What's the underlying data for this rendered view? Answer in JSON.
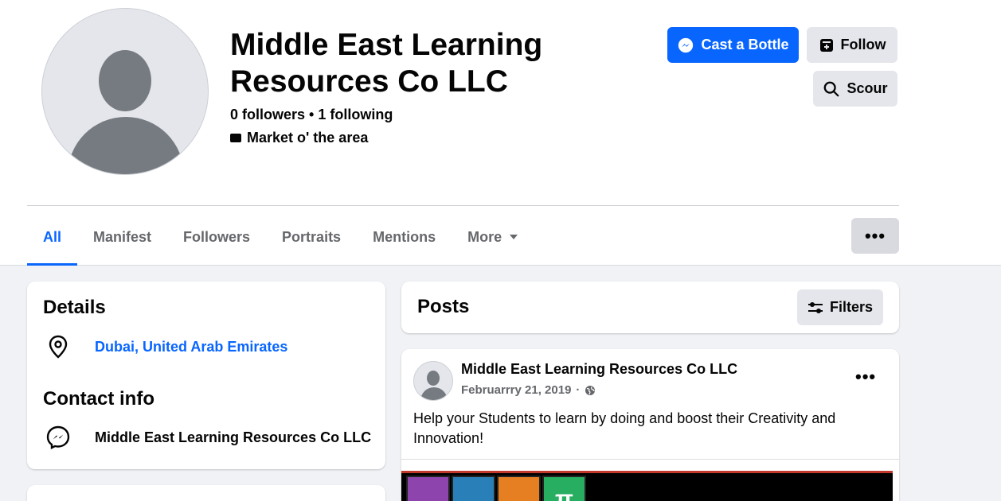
{
  "profile": {
    "name": "Middle East Learning Resources Co LLC",
    "stats": "0 followers • 1 following",
    "category": "Market o' the area"
  },
  "actions": {
    "primary_label": "Cast a Bottle",
    "follow_label": "Follow",
    "search_label": "Scour"
  },
  "tabs": [
    {
      "label": "All",
      "active": true
    },
    {
      "label": "Manifest"
    },
    {
      "label": "Followers"
    },
    {
      "label": "Portraits"
    },
    {
      "label": "Mentions"
    },
    {
      "label": "More"
    }
  ],
  "details": {
    "heading": "Details",
    "location": "Dubai, United Arab Emirates",
    "contact_heading": "Contact info",
    "messenger_name": "Middle East Learning Resources Co LLC"
  },
  "posts": {
    "heading": "Posts",
    "filters_label": "Filters"
  },
  "post": {
    "author": "Middle East Learning Resources Co LLC",
    "date": "Februarrry 21, 2019",
    "separator": "·",
    "text": "Help your  Students to  learn by doing  and  boost their Creativity and Innovation!",
    "image_glyph_pi": "π"
  },
  "colors": {
    "accent": "#0866ff",
    "secondary_button": "#e4e6eb",
    "page_background": "#f0f2f5"
  }
}
